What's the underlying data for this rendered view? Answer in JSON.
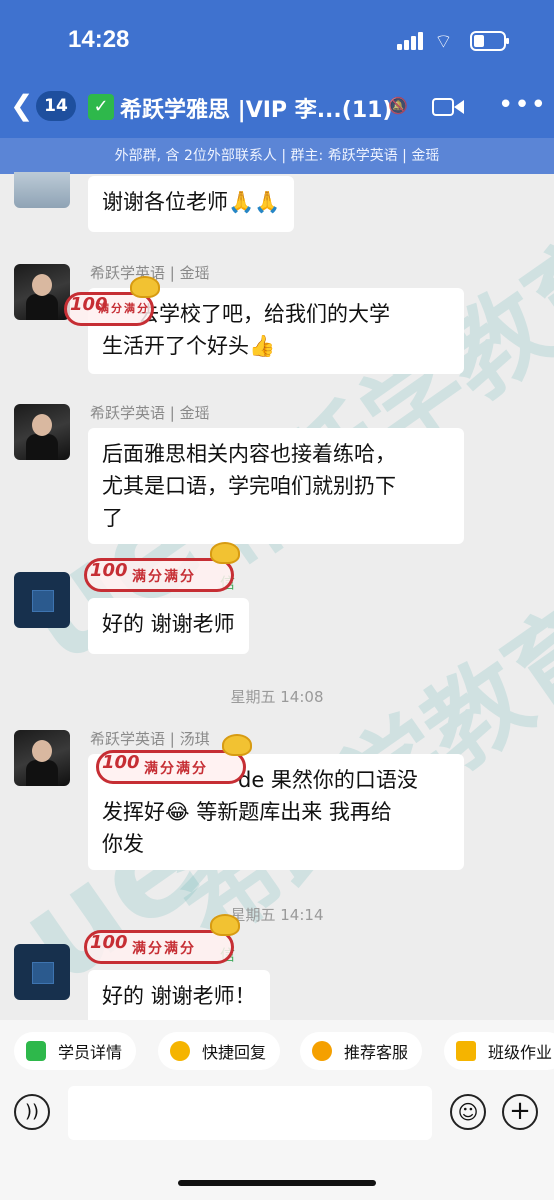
{
  "status_bar": {
    "time": "14:28"
  },
  "header": {
    "unread_count": "14",
    "title": "希跃学雅思 |VIP 李...(11)",
    "subtitle": "外部群, 含 2位外部联系人 | 群主: 希跃学英语 | 金瑶"
  },
  "messages": [
    {
      "sender": "",
      "text": "谢谢各位老师🙏🙏"
    },
    {
      "sender": "希跃学英语 | 金瑶",
      "text_line1": "去学校了吧，给我们的大学",
      "text_line2": "生活开了个好头👍"
    },
    {
      "sender": "希跃学英语 | 金瑶",
      "text_line1": "后面雅思相关内容也接着练哈，",
      "text_line2": "尤其是口语，学完咱们就别扔下",
      "text_line3": "了"
    },
    {
      "sender": "信",
      "text": "好的 谢谢老师"
    },
    {
      "timestamp": "星期五 14:08"
    },
    {
      "sender": "希跃学英语 | 汤琪",
      "text_line1": "de 果然你的口语没",
      "text_line2": "发挥好😂 等新题库出来 我再给",
      "text_line3": "你发"
    },
    {
      "timestamp": "星期五 14:14"
    },
    {
      "sender": "信",
      "text": "好的 谢谢老师！"
    }
  ],
  "stamp": {
    "number": "100",
    "text": "满分满分"
  },
  "watermark": {
    "text": "希跃学教育",
    "logo": "ue"
  },
  "quick_actions": [
    {
      "label": "学员详情",
      "icon": "student-icon",
      "color": "#2eb84b"
    },
    {
      "label": "快捷回复",
      "icon": "quick-reply-icon",
      "color": "#f5b400"
    },
    {
      "label": "推荐客服",
      "icon": "service-icon",
      "color": "#f5a000"
    },
    {
      "label": "班级作业",
      "icon": "homework-icon",
      "color": "#f5b400"
    }
  ],
  "colors": {
    "header": "#3f72cf",
    "subbar": "#5b85d6",
    "stamp": "#c62e34"
  }
}
